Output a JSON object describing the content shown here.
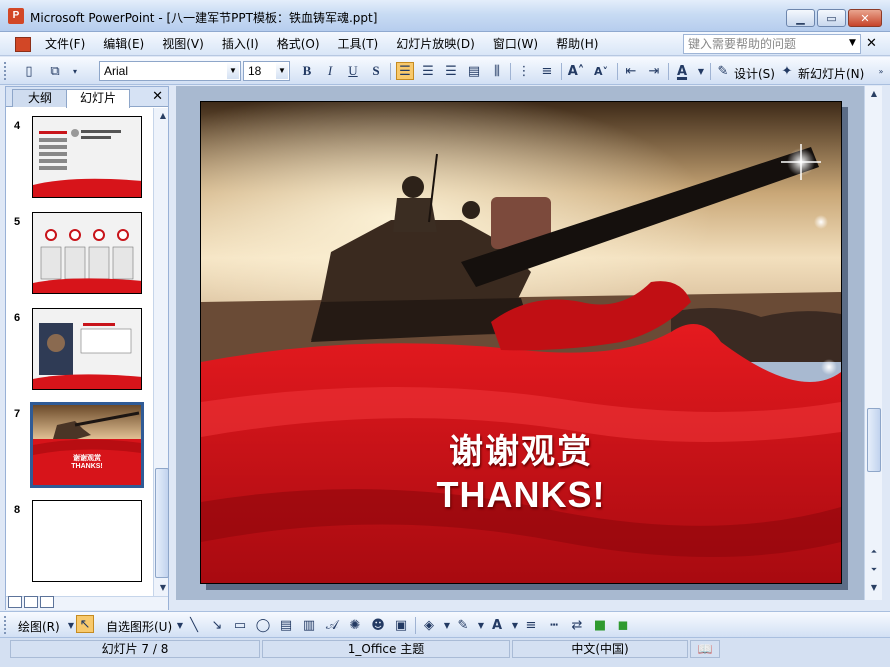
{
  "window": {
    "title": "Microsoft PowerPoint - [八一建军节PPT模板：铁血铸军魂.ppt]",
    "app_icon": "powerpoint-icon"
  },
  "menu": {
    "items": [
      "文件(F)",
      "编辑(E)",
      "视图(V)",
      "插入(I)",
      "格式(O)",
      "工具(T)",
      "幻灯片放映(D)",
      "窗口(W)",
      "帮助(H)"
    ],
    "help_placeholder": "键入需要帮助的问题"
  },
  "toolbar": {
    "font": "Arial",
    "size": "18",
    "bold": "B",
    "italic": "I",
    "underline": "U",
    "shadow": "S",
    "design_label": "设计(S)",
    "new_slide_label": "新幻灯片(N)"
  },
  "left_pane": {
    "tab_outline": "大纲",
    "tab_slides": "幻灯片",
    "thumbnails": [
      {
        "num": "4"
      },
      {
        "num": "5"
      },
      {
        "num": "6"
      },
      {
        "num": "7",
        "title_cn": "谢谢观赏",
        "title_en": "THANKS!",
        "selected": true
      },
      {
        "num": "8"
      }
    ]
  },
  "slide": {
    "title_cn": "谢谢观赏",
    "title_en": "THANKS!"
  },
  "drawbar": {
    "draw_label": "绘图(R)",
    "autoshape_label": "自选图形(U)"
  },
  "status": {
    "slide_info": "幻灯片 7 / 8",
    "theme": "1_Office 主题",
    "language": "中文(中国)"
  },
  "colors": {
    "accent_red": "#d7141a",
    "selection_blue": "#305b96",
    "ui_blue": "#d2e0f4"
  }
}
